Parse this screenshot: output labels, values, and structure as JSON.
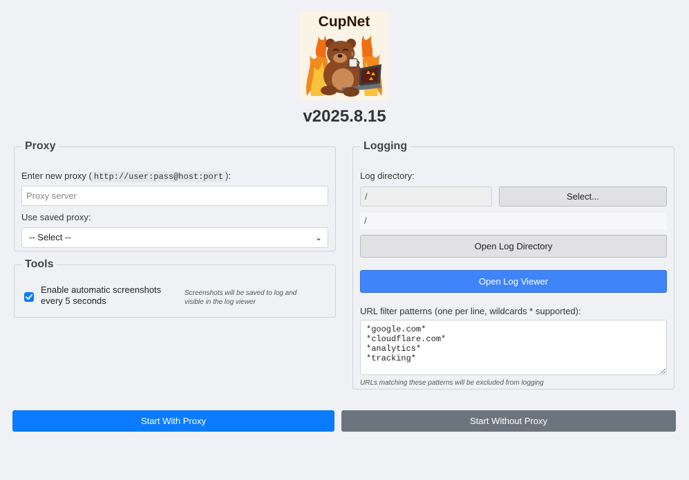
{
  "app": {
    "logo_title": "CupNet",
    "version": "v2025.8.15"
  },
  "proxy": {
    "legend": "Proxy",
    "new_label_prefix": "Enter new proxy (",
    "new_label_code": "http://user:pass@host:port",
    "new_label_suffix": "):",
    "input_placeholder": "Proxy server",
    "saved_label": "Use saved proxy:",
    "saved_selected": "-- Select --"
  },
  "tools": {
    "legend": "Tools",
    "screenshot_checkbox_checked": true,
    "screenshot_label": "Enable automatic screenshots every 5 seconds",
    "screenshot_note": "Screenshots will be saved to log and visible in the log viewer"
  },
  "logging": {
    "legend": "Logging",
    "dir_label": "Log directory:",
    "dir_value": "/",
    "select_button": "Select...",
    "current_dir": "/",
    "open_dir_button": "Open Log Directory",
    "open_viewer_button": "Open Log Viewer",
    "filter_label": "URL filter patterns (one per line, wildcards * supported):",
    "filter_value": "*google.com*\n*cloudflare.com*\n*analytics*\n*tracking*",
    "filter_note": "URLs matching these patterns will be excluded from logging"
  },
  "actions": {
    "start_with_proxy": "Start With Proxy",
    "start_without_proxy": "Start Without Proxy"
  },
  "colors": {
    "primary": "#0b7bff",
    "secondary": "#6c757d",
    "accent_blue": "#3f84f8",
    "background": "#f0f1f5"
  }
}
